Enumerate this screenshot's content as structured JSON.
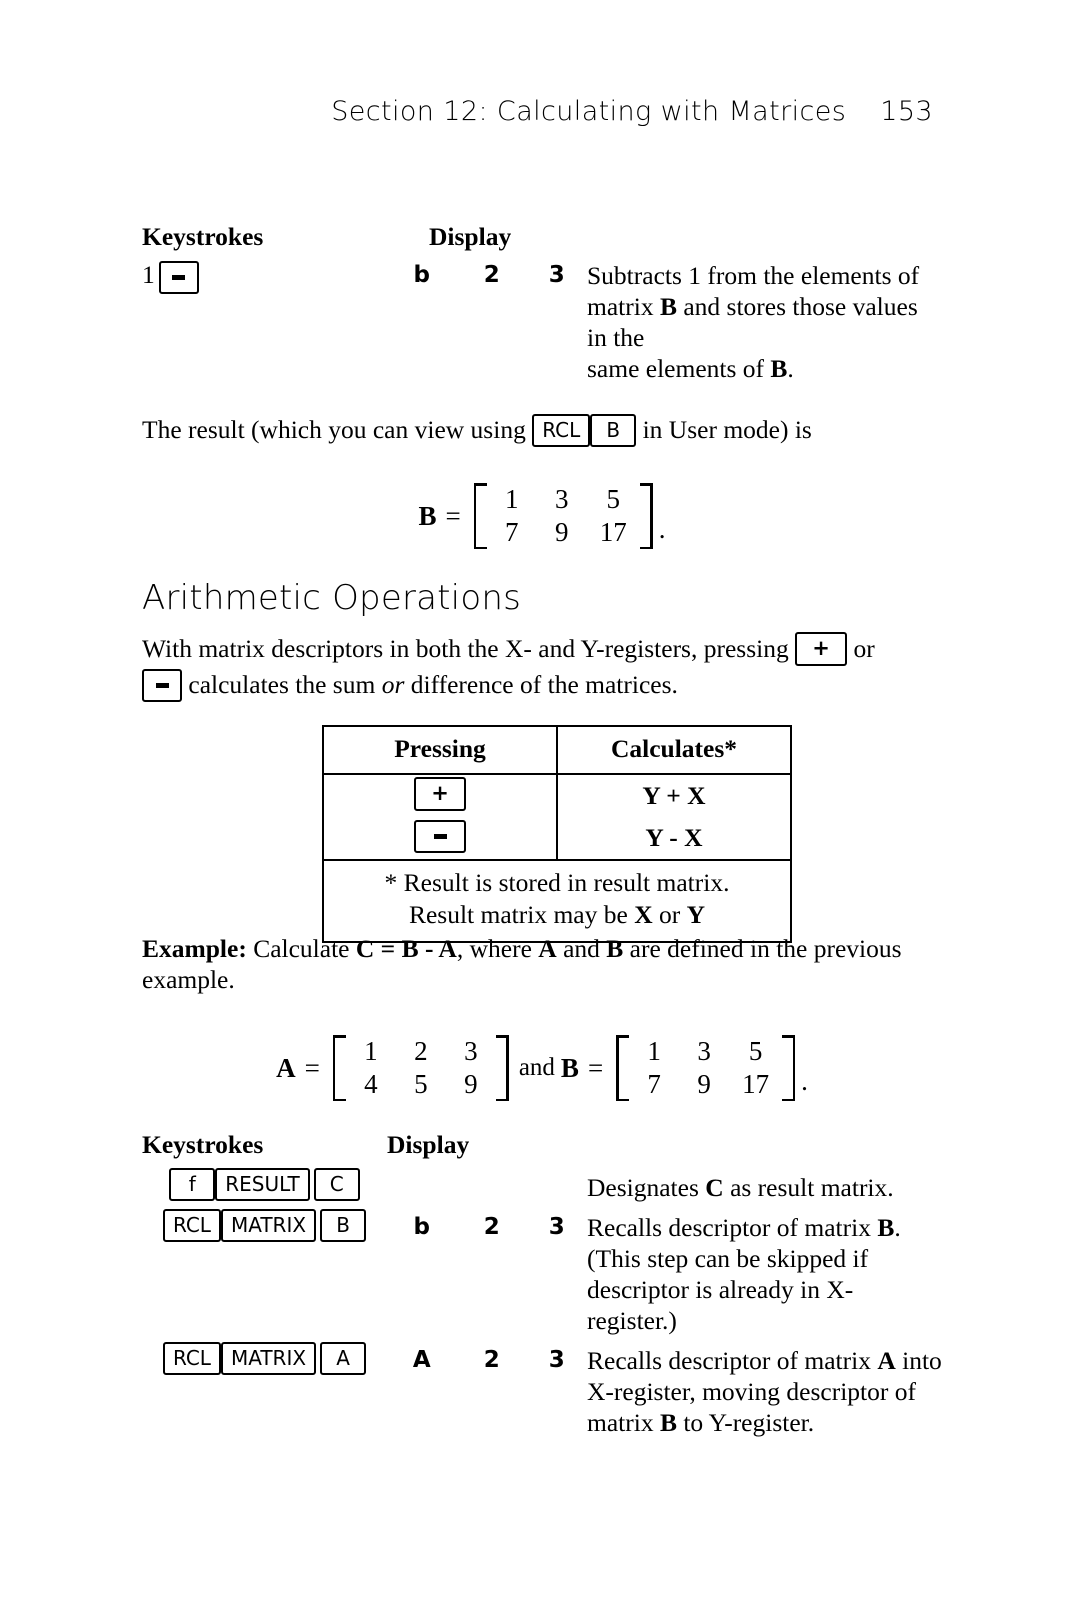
{
  "header": {
    "title": "Section 12: Calculating with Matrices",
    "page_number": "153"
  },
  "keystroke_headers": {
    "keystrokes": "Keystrokes",
    "display": "Display"
  },
  "first_step": {
    "operand": "1",
    "key_minus": "-",
    "display": [
      "b",
      "2",
      "3"
    ],
    "description_line1_a": "Subtracts 1 from the elements of",
    "description_line2_a": "matrix ",
    "description_line2_b": "B",
    "description_line2_c": " and stores those values in the",
    "description_line3_a": "same elements of ",
    "description_line3_b": "B",
    "description_line3_c": "."
  },
  "result_paragraph": {
    "before": "The result (which you can view using",
    "key_rcl": "RCL",
    "key_b": "B",
    "after": "in User mode) is"
  },
  "matrix_b_result": {
    "label": "B",
    "equals": "=",
    "rows": [
      [
        "1",
        "3",
        "5"
      ],
      [
        "7",
        "9",
        "17"
      ]
    ],
    "trailing": "."
  },
  "section": {
    "heading": "Arithmetic Operations",
    "intro_a": "With matrix descriptors in both the X- and Y-registers, pressing",
    "key_plus": "+",
    "intro_b": "or",
    "key_minus": "-",
    "intro_c_a": "calculates the sum ",
    "intro_c_b": "or",
    "intro_c_c": " difference of the matrices."
  },
  "ops_table": {
    "headers": [
      "Pressing",
      "Calculates*"
    ],
    "rows": [
      {
        "key": "+",
        "calculates": "Y + X"
      },
      {
        "key": "-",
        "calculates": "Y - X"
      }
    ],
    "footnote_line1": "* Result is stored in result matrix.",
    "footnote_line2_a": "Result matrix may be ",
    "footnote_line2_b": "X",
    "footnote_line2_c": " or ",
    "footnote_line2_d": "Y"
  },
  "example": {
    "label": "Example:",
    "text_a": " Calculate ",
    "eq_c": "C = B - A",
    "text_b": ", where ",
    "var_a": "A",
    "text_c": " and ",
    "var_b": "B",
    "text_d": " are defined in the previous",
    "line2": "example.",
    "matrix_a": {
      "label": "A",
      "equals": "=",
      "rows": [
        [
          "1",
          "2",
          "3"
        ],
        [
          "4",
          "5",
          "9"
        ]
      ]
    },
    "conjunction": "and",
    "matrix_b": {
      "label": "B",
      "equals": "=",
      "rows": [
        [
          "1",
          "3",
          "5"
        ],
        [
          "7",
          "9",
          "17"
        ]
      ]
    },
    "trailing": "."
  },
  "steps": [
    {
      "keys": [
        "f",
        "RESULT",
        "C"
      ],
      "display": [
        "",
        "",
        ""
      ],
      "desc_lines": [
        [
          {
            "t": "Designates ",
            "b": false
          },
          {
            "t": "C",
            "b": true
          },
          {
            "t": " as result matrix.",
            "b": false
          }
        ]
      ]
    },
    {
      "keys": [
        "RCL",
        "MATRIX",
        "B"
      ],
      "display": [
        "b",
        "2",
        "3"
      ],
      "desc_lines": [
        [
          {
            "t": "Recalls descriptor of matrix ",
            "b": false
          },
          {
            "t": "B",
            "b": true
          },
          {
            "t": ".",
            "b": false
          }
        ],
        [
          {
            "t": "(This step can be skipped if",
            "b": false
          }
        ],
        [
          {
            "t": "descriptor is already in X-register.)",
            "b": false
          }
        ]
      ]
    },
    {
      "keys": [
        "RCL",
        "MATRIX",
        "A"
      ],
      "display": [
        "A",
        "2",
        "3"
      ],
      "desc_lines": [
        [
          {
            "t": "Recalls descriptor of matrix ",
            "b": false
          },
          {
            "t": "A",
            "b": true
          },
          {
            "t": " into",
            "b": false
          }
        ],
        [
          {
            "t": "X-register, moving descriptor of",
            "b": false
          }
        ],
        [
          {
            "t": "matrix ",
            "b": false
          },
          {
            "t": "B",
            "b": true
          },
          {
            "t": " to Y-register.",
            "b": false
          }
        ]
      ]
    }
  ]
}
